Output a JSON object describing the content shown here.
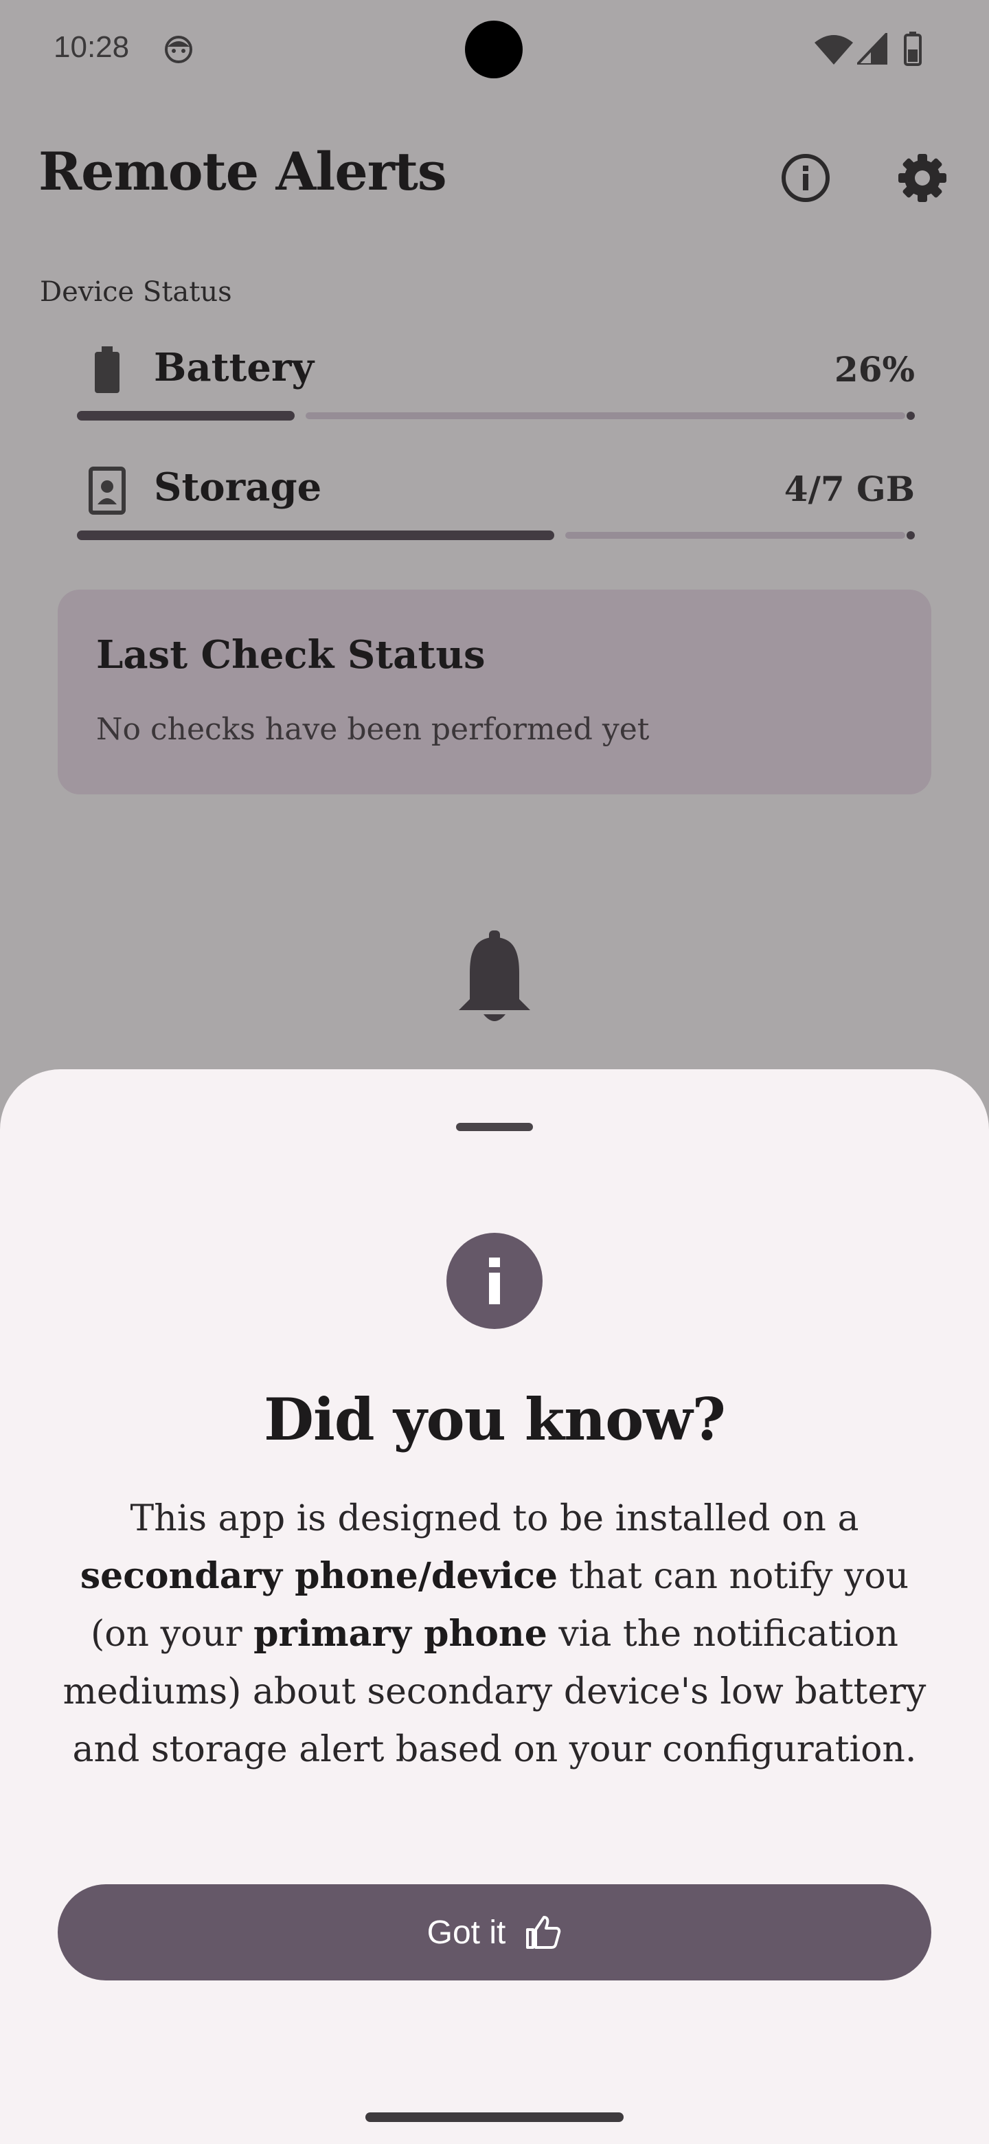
{
  "status_bar": {
    "time": "10:28",
    "icons": [
      "face-icon",
      "wifi-icon",
      "signal-icon",
      "battery-icon"
    ]
  },
  "header": {
    "title": "Remote Alerts",
    "info_icon": "info-icon",
    "settings_icon": "gear-icon"
  },
  "device_status": {
    "section_label": "Device Status",
    "battery": {
      "label": "Battery",
      "value": "26%",
      "level": 0.26,
      "icon": "battery-icon"
    },
    "storage": {
      "label": "Storage",
      "value": "4/7 GB",
      "level": 0.57,
      "icon": "storage-icon"
    }
  },
  "last_check": {
    "title": "Last Check Status",
    "message": "No checks have been performed yet"
  },
  "main_icon": "bell-icon",
  "sheet": {
    "icon": "info-icon",
    "title": "Did you know?",
    "body": {
      "p1": "This app is designed to be installed on a ",
      "b1": "secondary phone/device",
      "p2": " that can notify you (on your ",
      "b2": "primary phone",
      "p3": " via the notification mediums) about secondary device's low battery and storage alert based on your configuration."
    },
    "button_label": "Got it",
    "button_icon": "thumbs-up-icon"
  },
  "colors": {
    "scrim_background": "#aaa7a8",
    "sheet_background": "#f7f2f4",
    "accent": "#655868",
    "card": "#a0969e"
  }
}
